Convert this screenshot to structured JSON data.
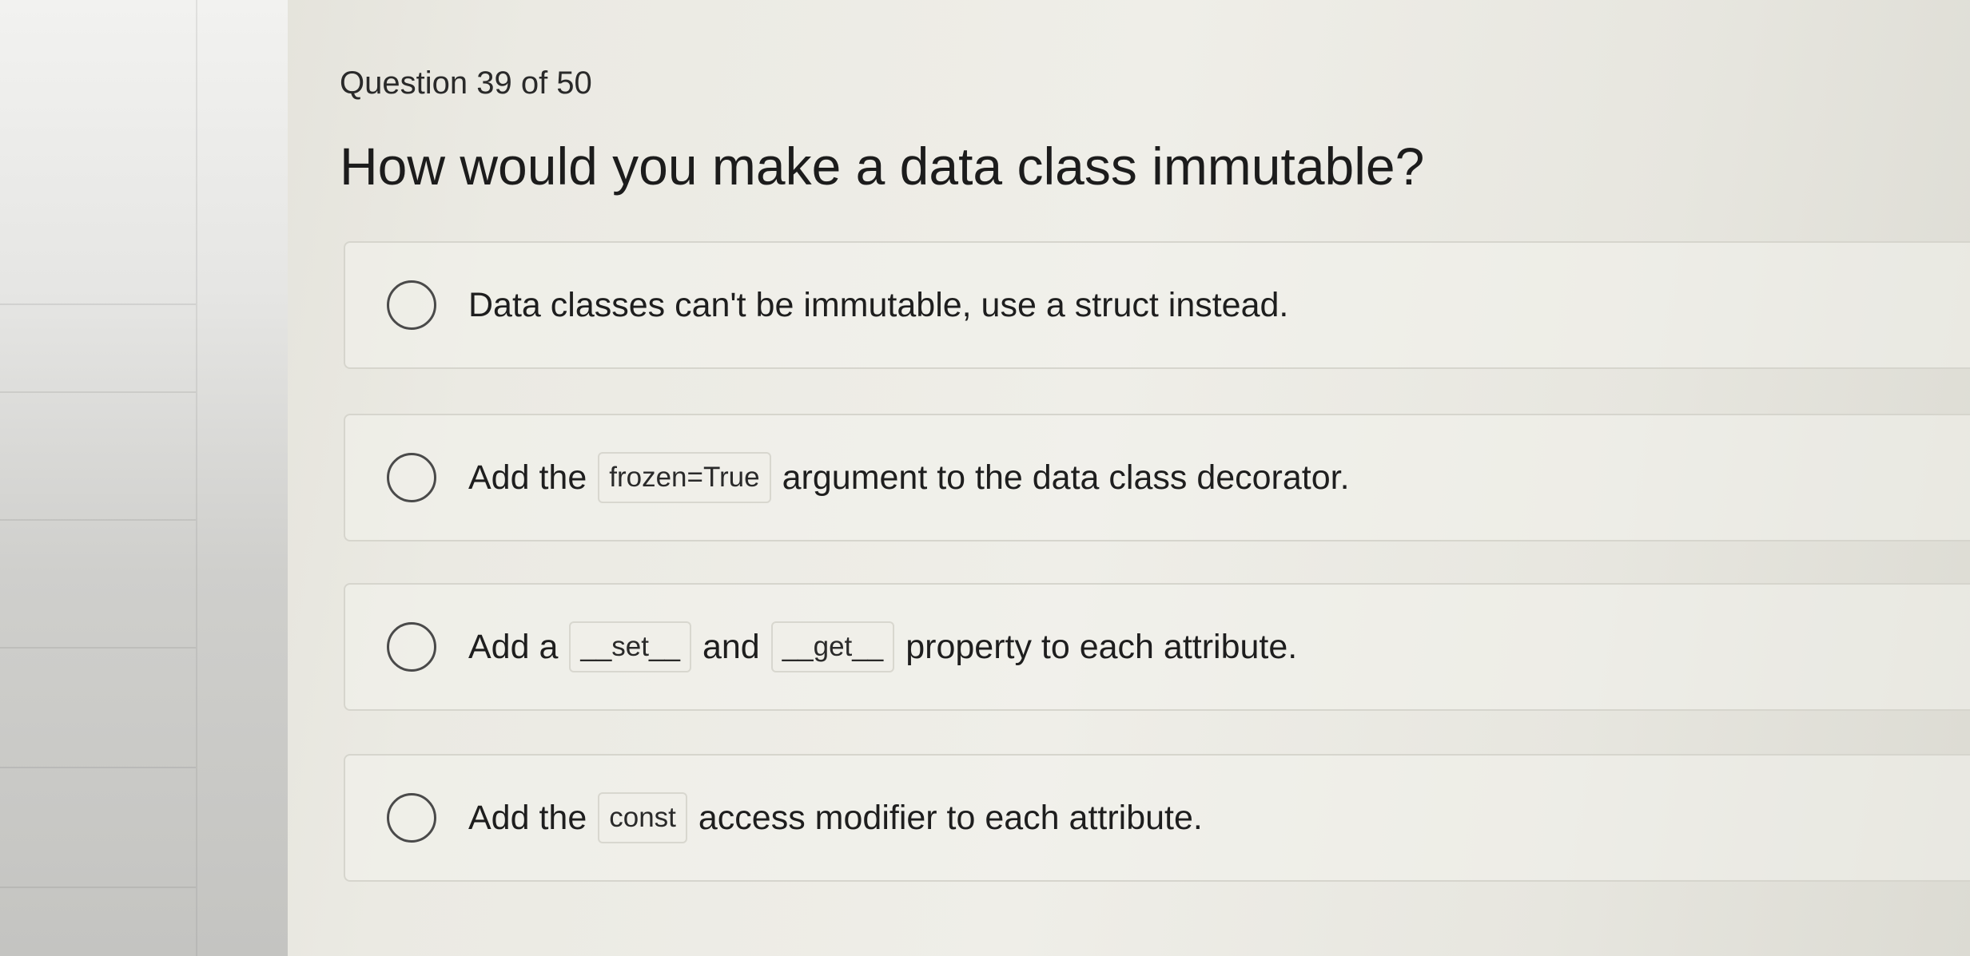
{
  "quiz": {
    "counter": "Question 39 of 50",
    "question": "How would you make a data class immutable?",
    "options": [
      {
        "text": "Data classes can't be immutable, use a struct instead."
      },
      {
        "pre": "Add the",
        "code": "frozen=True",
        "post": "argument to the data class decorator."
      },
      {
        "pre": "Add a",
        "code1": "__set__",
        "mid": "and",
        "code2": "__get__",
        "post": "property to each attribute."
      },
      {
        "pre": "Add the",
        "code": "const",
        "post": "access modifier to each attribute."
      }
    ]
  },
  "icons": {
    "radio": "radio-unselected-icon"
  }
}
